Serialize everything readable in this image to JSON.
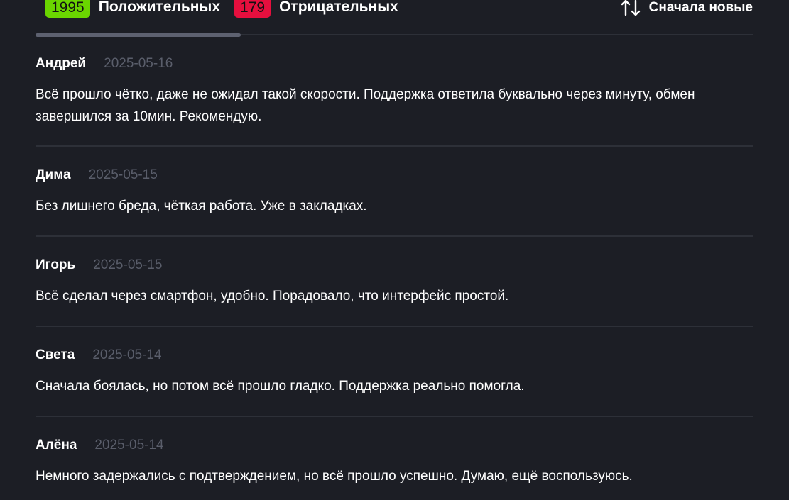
{
  "filters": {
    "positive": {
      "count": "1995",
      "label": "Положительных",
      "color": "#6ad500"
    },
    "negative": {
      "count": "179",
      "label": "Отрицательных",
      "color": "#e60f3e"
    }
  },
  "sort": {
    "icon": "sort-arrows-icon",
    "label": "Сначала новые"
  },
  "reviews": [
    {
      "name": "Андрей",
      "date": "2025-05-16",
      "text": "Всё прошло чётко, даже не ожидал такой скорости. Поддержка ответила буквально через минуту, обмен завершился за 10мин. Рекомендую."
    },
    {
      "name": "Дима",
      "date": "2025-05-15",
      "text": "Без лишнего бреда, чёткая работа. Уже в закладках."
    },
    {
      "name": "Игорь",
      "date": "2025-05-15",
      "text": "Всё сделал через смартфон, удобно. Порадовало, что интерфейс простой."
    },
    {
      "name": "Света",
      "date": "2025-05-14",
      "text": "Сначала боялась, но потом всё прошло гладко. Поддержка реально помогла."
    },
    {
      "name": "Алёна",
      "date": "2025-05-14",
      "text": "Немного задержались с подтверждением, но всё прошло успешно. Думаю, ещё воспользуюсь."
    }
  ]
}
